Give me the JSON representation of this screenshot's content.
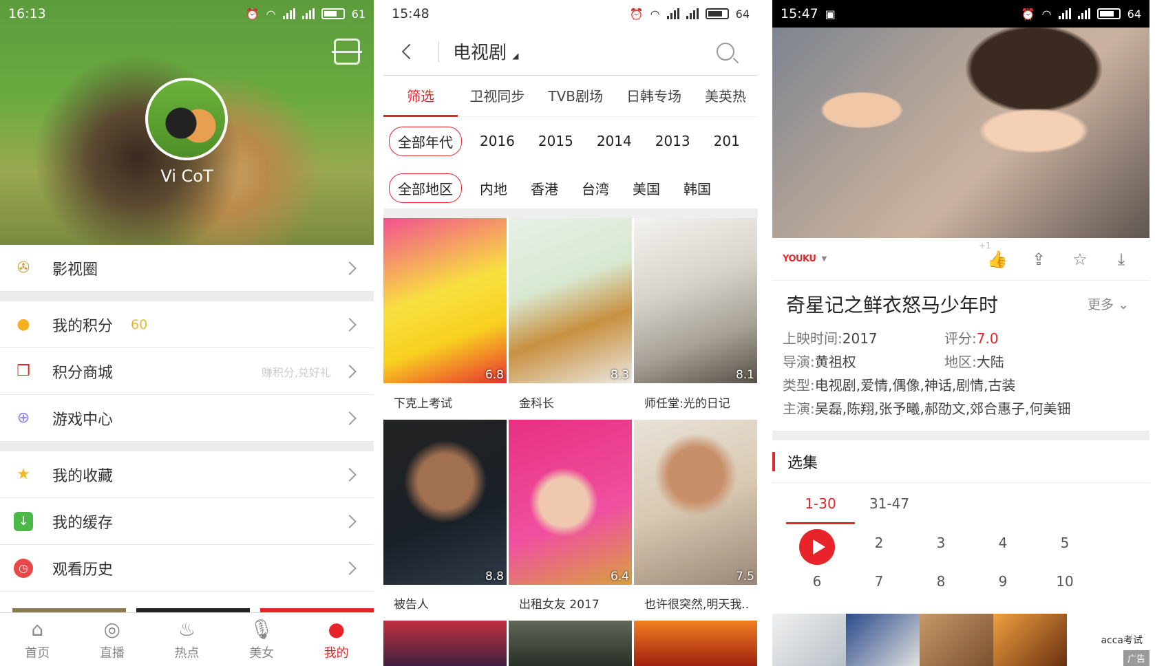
{
  "screen1": {
    "status": {
      "time": "16:13",
      "battery": "61"
    },
    "profile": {
      "username": "Vi CoT"
    },
    "menu": [
      {
        "label": "影视圈",
        "icon": "film-reel-icon"
      },
      {
        "label": "我的积分",
        "value": "60",
        "icon": "piggy-bank-icon"
      },
      {
        "label": "积分商城",
        "hint": "赚积分,兑好礼",
        "icon": "gift-icon"
      },
      {
        "label": "游戏中心",
        "icon": "gamepad-icon"
      },
      {
        "label": "我的收藏",
        "icon": "star-icon"
      },
      {
        "label": "我的缓存",
        "icon": "download-icon"
      },
      {
        "label": "观看历史",
        "icon": "clock-icon"
      }
    ],
    "tabs": [
      {
        "label": "首页",
        "icon": "home-icon"
      },
      {
        "label": "直播",
        "icon": "live-icon"
      },
      {
        "label": "热点",
        "icon": "flame-icon"
      },
      {
        "label": "美女",
        "icon": "microphone-icon"
      },
      {
        "label": "我的",
        "icon": "user-icon",
        "active": true
      }
    ]
  },
  "screen2": {
    "status": {
      "time": "15:48",
      "battery": "64"
    },
    "title": "电视剧",
    "category_tabs": [
      "筛选",
      "卫视同步",
      "TVB剧场",
      "日韩专场",
      "美英热"
    ],
    "years": [
      "全部年代",
      "2016",
      "2015",
      "2014",
      "2013",
      "201"
    ],
    "regions": [
      "全部地区",
      "内地",
      "香港",
      "台湾",
      "美国",
      "韩国"
    ],
    "shows": [
      {
        "title": "下克上考试",
        "score": "6.8"
      },
      {
        "title": "金科长",
        "score": "8.3"
      },
      {
        "title": "师任堂:光的日记",
        "score": "8.1"
      },
      {
        "title": "被告人",
        "score": "8.8"
      },
      {
        "title": "出租女友 2017",
        "score": "6.4"
      },
      {
        "title": "也许很突然,明天我..",
        "score": "7.5"
      }
    ]
  },
  "screen3": {
    "status": {
      "time": "15:47",
      "battery": "64"
    },
    "brand": "YOUKU",
    "like_plus": "+1",
    "show": {
      "title": "奇星记之鲜衣怒马少年时",
      "more": "更多",
      "release_label": "上映时间:",
      "release": "2017",
      "rating_label": "评分:",
      "rating": "7.0",
      "director_label": "导演:",
      "director": "黄祖权",
      "region_label": "地区:",
      "region": "大陆",
      "genre_label": "类型:",
      "genre": "电视剧,爱情,偶像,神话,剧情,古装",
      "cast_label": "主演:",
      "cast": "吴磊,陈翔,张予曦,郝劭文,郊合惠子,何美钿"
    },
    "episodes_label": "选集",
    "episode_tabs": [
      "1-30",
      "31-47"
    ],
    "episodes": [
      "2",
      "3",
      "4",
      "5",
      "6",
      "7",
      "8",
      "9",
      "10"
    ],
    "ad": {
      "text": "acca考试",
      "tag": "广告"
    }
  }
}
